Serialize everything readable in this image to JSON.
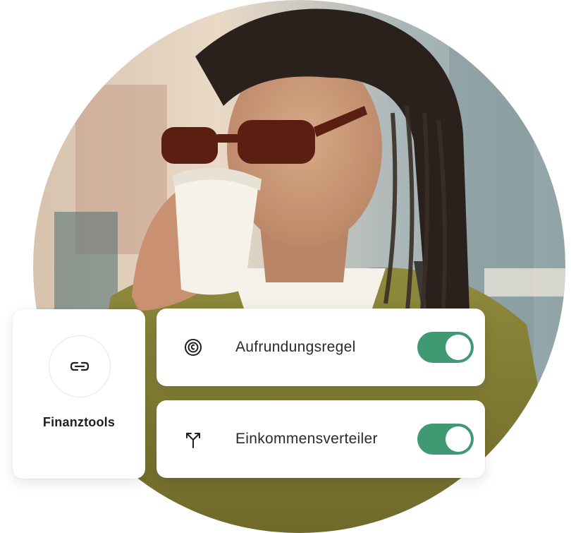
{
  "photo": {
    "subject": "photo"
  },
  "tools_card": {
    "label": "Finanztools",
    "icon": "link-icon"
  },
  "settings": [
    {
      "label": "Aufrundungsregel",
      "icon": "coin-round-up-icon",
      "enabled": true
    },
    {
      "label": "Einkommensverteiler",
      "icon": "split-arrows-icon",
      "enabled": true
    }
  ],
  "colors": {
    "toggle_on": "#3f9a73",
    "card_bg": "#ffffff",
    "text": "#2a2a2a"
  }
}
